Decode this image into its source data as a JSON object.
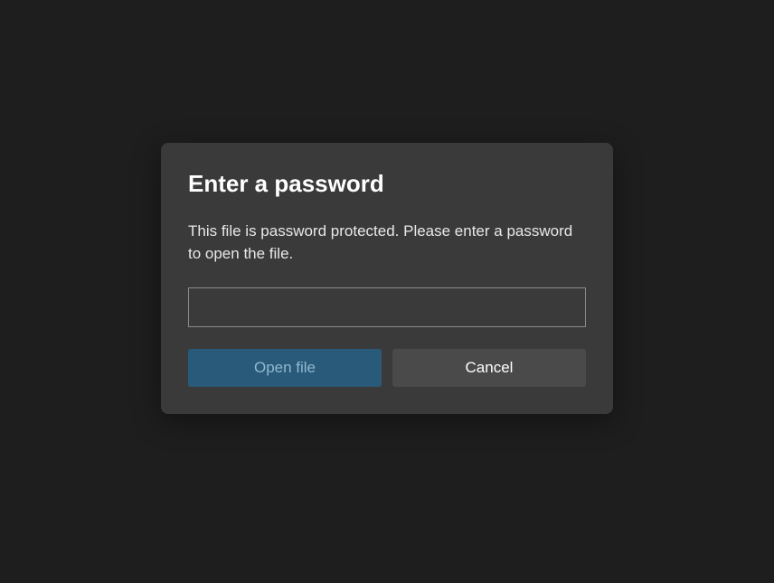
{
  "dialog": {
    "title": "Enter a password",
    "message": "This file is password protected. Please enter a password to open the file.",
    "password_value": "",
    "buttons": {
      "primary_label": "Open file",
      "secondary_label": "Cancel"
    }
  }
}
